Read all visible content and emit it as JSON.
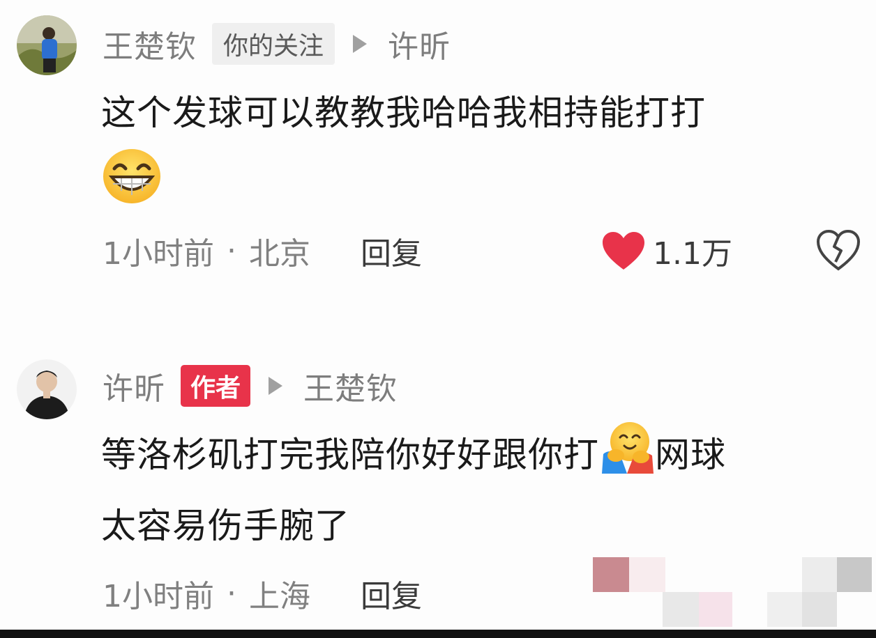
{
  "comments": [
    {
      "username": "王楚钦",
      "badge": "你的关注",
      "reply_to": "许昕",
      "text": "这个发球可以教教我哈哈我相持能打打",
      "emoji": "grinning-face-emoji",
      "time": "1小时前",
      "separator": "·",
      "location": "北京",
      "reply_label": "回复",
      "likes": "1.1万"
    },
    {
      "username": "许昕",
      "badge": "作者",
      "reply_to": "王楚钦",
      "text_part1": "等洛杉矶打完我陪你好好跟你打",
      "emoji": "hugging-face-emoji",
      "text_part2": "网球",
      "text_line2": "太容易伤手腕了",
      "time": "1小时前",
      "separator": "·",
      "location": "上海",
      "reply_label": "回复"
    }
  ],
  "colors": {
    "like_red": "#e8334a",
    "author_badge": "#e8334a",
    "muted_text": "#808080"
  }
}
